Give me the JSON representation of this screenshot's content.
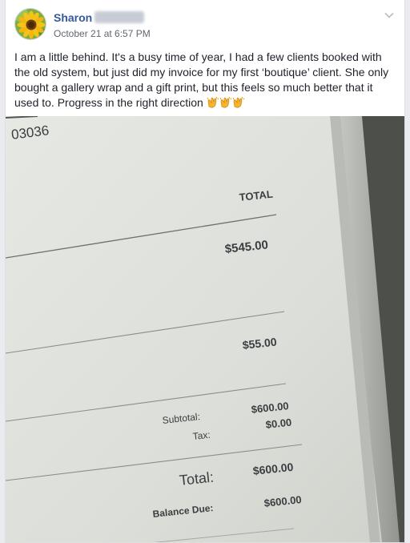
{
  "post": {
    "author_name": "Sharon",
    "timestamp": "October 21 at 6:57 PM",
    "text": "I am a little behind. It's a busy time of year, I had a few clients booked with the old system, but just did my invoice for my first ‘boutique’ client. She only bought a gallery wrap and a gift print, but this feels so much better that it used to. Progress in the right direction ",
    "emojis": [
      "clapping-hands",
      "clapping-hands",
      "clapping-hands"
    ],
    "menu_icon": "chevron-down-icon",
    "avatar_icon": "sunflower-avatar"
  },
  "photo": {
    "invoice_number_fragment": "03036",
    "total_header": "TOTAL",
    "line_items": [
      "$545.00",
      "$55.00"
    ],
    "subtotal_label": "Subtotal:",
    "subtotal_value": "$600.00",
    "tax_label": "Tax:",
    "tax_value": "$0.00",
    "total_label": "Total:",
    "total_value": "$600.00",
    "balance_label": "Balance Due:",
    "balance_value": "$600.00"
  }
}
